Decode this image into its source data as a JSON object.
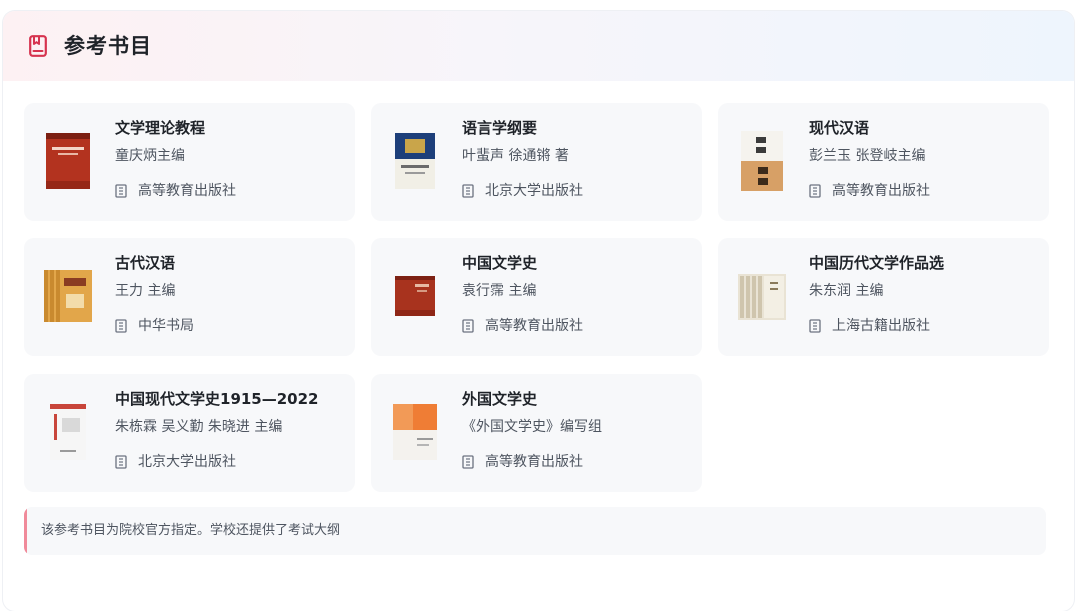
{
  "header": {
    "title": "参考书目",
    "icon": "book-icon",
    "accent_color": "#d6334f"
  },
  "books": [
    {
      "title": "文学理论教程",
      "author": "童庆炳主编",
      "publisher": "高等教育出版社",
      "cover_icon": "book-cover-image"
    },
    {
      "title": "语言学纲要",
      "author": "叶蜚声 徐通锵 著",
      "publisher": "北京大学出版社",
      "cover_icon": "book-cover-image"
    },
    {
      "title": "现代汉语",
      "author": "彭兰玉 张登岐主编",
      "publisher": "高等教育出版社",
      "cover_icon": "book-cover-image"
    },
    {
      "title": "古代汉语",
      "author": "王力 主编",
      "publisher": "中华书局",
      "cover_icon": "book-cover-image"
    },
    {
      "title": "中国文学史",
      "author": "袁行霈 主编",
      "publisher": "高等教育出版社",
      "cover_icon": "book-cover-image"
    },
    {
      "title": "中国历代文学作品选",
      "author": "朱东润 主编",
      "publisher": "上海古籍出版社",
      "cover_icon": "book-cover-image"
    },
    {
      "title": "中国现代文学史1915—2022",
      "author": "朱栋霖 吴义勤 朱晓进 主编",
      "publisher": "北京大学出版社",
      "cover_icon": "book-cover-image"
    },
    {
      "title": "外国文学史",
      "author": "《外国文学史》编写组",
      "publisher": "高等教育出版社",
      "cover_icon": "book-cover-image"
    }
  ],
  "publisher_icon": "building-icon",
  "note": {
    "text": "该参考书目为院校官方指定。学校还提供了考试大纲",
    "accent_color": "#f08a9a"
  }
}
